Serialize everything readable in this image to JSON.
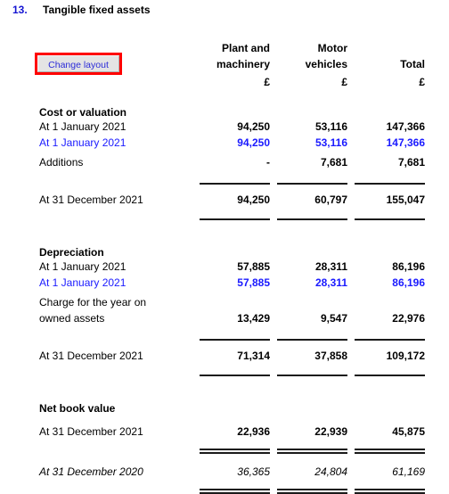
{
  "note": {
    "number": "13.",
    "title": "Tangible fixed assets"
  },
  "toolbar": {
    "change_layout_label": "Change layout"
  },
  "columns": {
    "label": "",
    "plant_line1": "Plant and",
    "plant_line2": "machinery",
    "motor_line1": "Motor",
    "motor_line2": "vehicles",
    "total_line1": "",
    "total_line2": "Total",
    "currency": "£"
  },
  "sections": [
    {
      "heading": "Cost or valuation",
      "rows": [
        {
          "label": "At 1 January 2021",
          "plant": "94,250",
          "motor": "53,116",
          "total": "147,366",
          "style": "black"
        },
        {
          "label": "At 1 January 2021",
          "plant": "94,250",
          "motor": "53,116",
          "total": "147,366",
          "style": "blue"
        },
        {
          "label": "Additions",
          "plant": "-",
          "motor": "7,681",
          "total": "7,681",
          "style": "black"
        }
      ],
      "subtotal": {
        "label": "At 31 December 2021",
        "plant": "94,250",
        "motor": "60,797",
        "total": "155,047"
      }
    },
    {
      "heading": "Depreciation",
      "rows": [
        {
          "label": "At 1 January 2021",
          "plant": "57,885",
          "motor": "28,311",
          "total": "86,196",
          "style": "black"
        },
        {
          "label": "At 1 January 2021",
          "plant": "57,885",
          "motor": "28,311",
          "total": "86,196",
          "style": "blue"
        },
        {
          "label": "Charge for the year on owned assets",
          "label_line1": "Charge for the year on",
          "label_line2": "owned assets",
          "plant": "13,429",
          "motor": "9,547",
          "total": "22,976",
          "style": "black"
        }
      ],
      "subtotal": {
        "label": "At 31 December 2021",
        "plant": "71,314",
        "motor": "37,858",
        "total": "109,172"
      }
    },
    {
      "heading": "Net book value",
      "rows": [],
      "current": {
        "label": "At 31 December 2021",
        "plant": "22,936",
        "motor": "22,939",
        "total": "45,875"
      },
      "prior": {
        "label": "At 31 December 2020",
        "plant": "36,365",
        "motor": "24,804",
        "total": "61,169"
      }
    }
  ],
  "colors": {
    "blue_text": "#1a1aff",
    "note_number": "#1414d2",
    "button_text": "#2b2bd8",
    "highlight_border": "#ff0000",
    "rule": "#1a1a1a"
  }
}
